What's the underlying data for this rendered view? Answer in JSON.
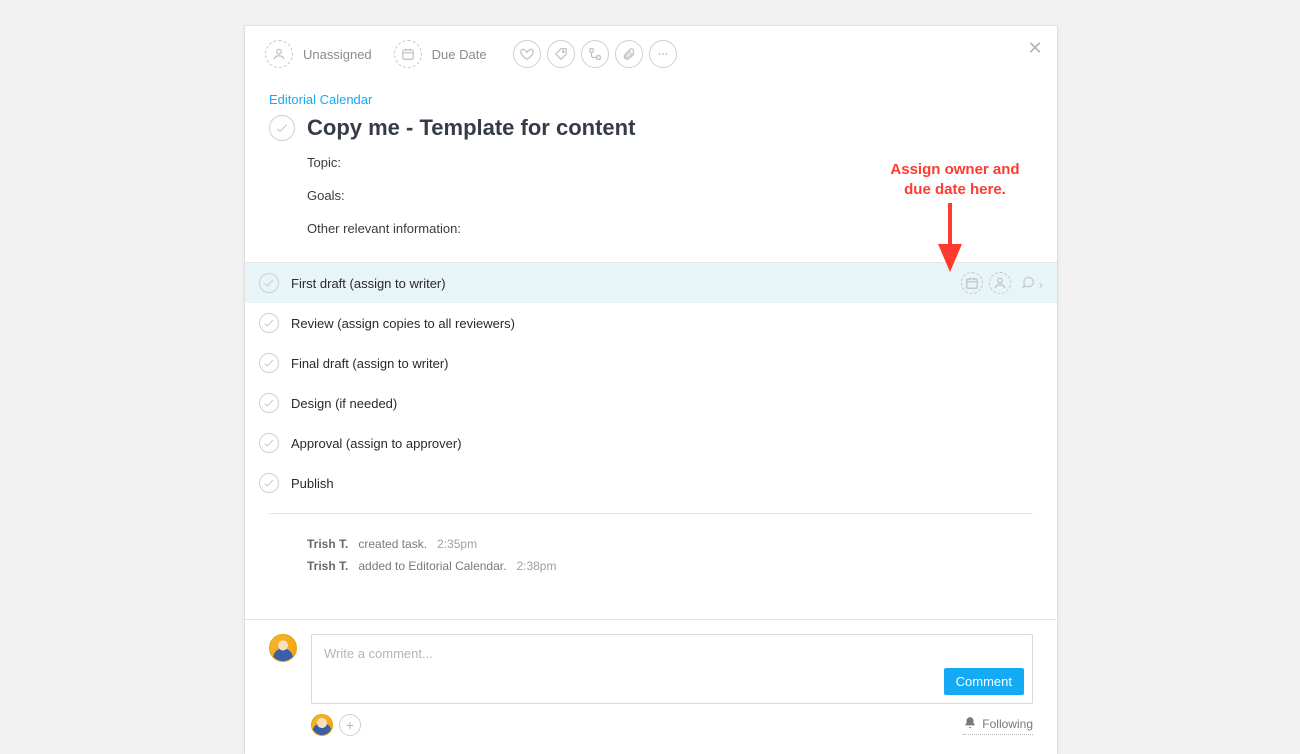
{
  "toolbar": {
    "assignee_label": "Unassigned",
    "due_date_label": "Due Date"
  },
  "project_link": "Editorial Calendar",
  "task_title": "Copy me - Template for content",
  "fields": {
    "topic": "Topic:",
    "goals": "Goals:",
    "other": "Other relevant information:"
  },
  "subtasks": [
    {
      "name": "First draft (assign to writer)",
      "highlighted": true
    },
    {
      "name": "Review (assign copies to all reviewers)",
      "highlighted": false
    },
    {
      "name": "Final draft (assign to writer)",
      "highlighted": false
    },
    {
      "name": "Design (if needed)",
      "highlighted": false
    },
    {
      "name": "Approval (assign to approver)",
      "highlighted": false
    },
    {
      "name": "Publish",
      "highlighted": false
    }
  ],
  "activity": [
    {
      "who": "Trish T.",
      "action": "created task.",
      "time": "2:35pm"
    },
    {
      "who": "Trish T.",
      "action": "added to Editorial Calendar.",
      "time": "2:38pm"
    }
  ],
  "comment": {
    "placeholder": "Write a comment...",
    "button": "Comment"
  },
  "following_label": "Following",
  "annotation": {
    "line1": "Assign owner and",
    "line2": "due date here."
  }
}
